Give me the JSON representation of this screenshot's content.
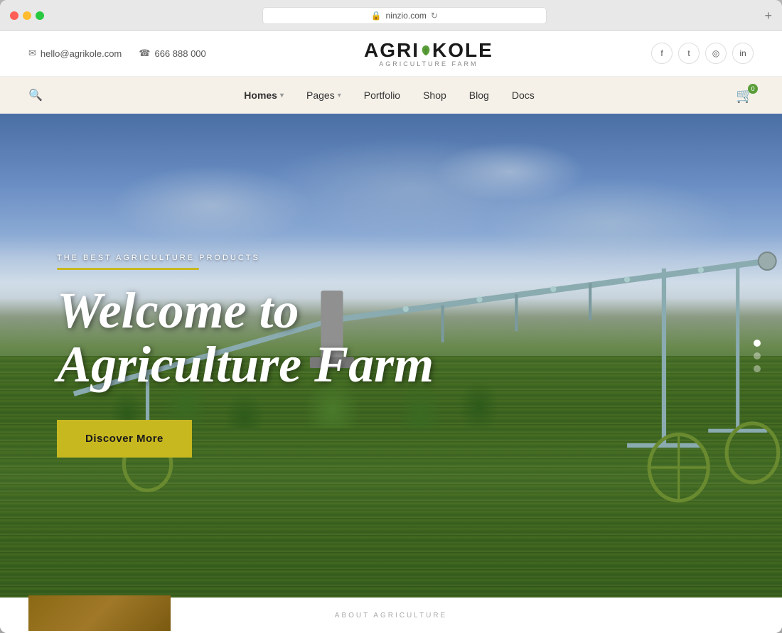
{
  "browser": {
    "url": "ninzio.com",
    "new_tab_label": "+"
  },
  "header": {
    "email": "hello@agrikole.com",
    "phone": "666 888 000",
    "logo_text": "AGRIKOLE",
    "logo_subtitle": "AGRICULTURE FARM",
    "social": [
      {
        "icon": "f",
        "name": "facebook"
      },
      {
        "icon": "t",
        "name": "twitter"
      },
      {
        "icon": "◎",
        "name": "instagram"
      },
      {
        "icon": "in",
        "name": "linkedin"
      }
    ]
  },
  "nav": {
    "items": [
      {
        "label": "Homes",
        "has_arrow": true
      },
      {
        "label": "Pages",
        "has_arrow": true
      },
      {
        "label": "Portfolio",
        "has_arrow": false
      },
      {
        "label": "Shop",
        "has_arrow": false
      },
      {
        "label": "Blog",
        "has_arrow": false
      },
      {
        "label": "Docs",
        "has_arrow": false
      }
    ],
    "active_item": "Homes",
    "cart_count": "0"
  },
  "hero": {
    "subtitle": "THE BEST AGRICULTURE PRODUCTS",
    "title_line1": "Welcome to",
    "title_line2": "Agriculture Farm",
    "cta_label": "Discover More",
    "slider_dots": [
      {
        "active": true
      },
      {
        "active": false
      },
      {
        "active": false
      }
    ]
  },
  "footer_preview": {
    "about_label": "ABOUT AGRICULTURE"
  },
  "icons": {
    "email_icon": "✉",
    "phone_icon": "☎",
    "search_icon": "🔍",
    "cart_icon": "🛒"
  }
}
